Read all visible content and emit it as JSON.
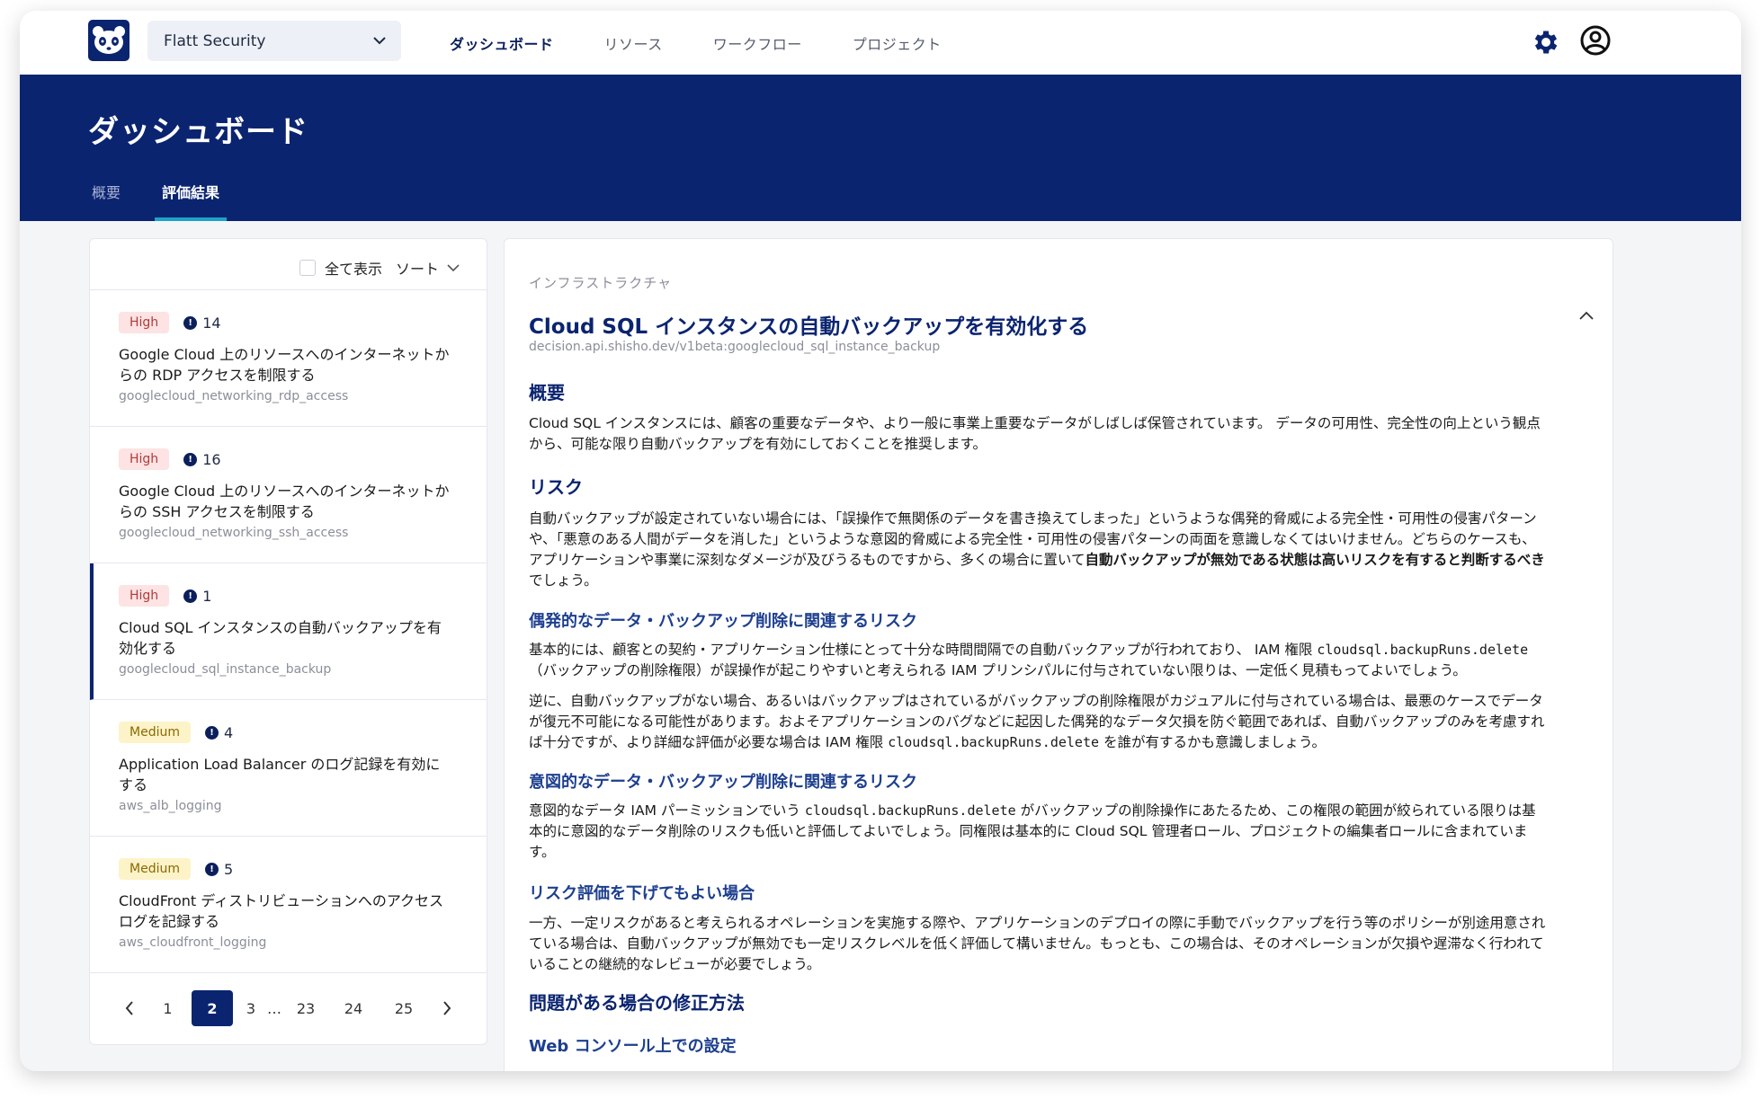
{
  "nav": {
    "org": "Flatt Security",
    "links": [
      "ダッシュボード",
      "リソース",
      "ワークフロー",
      "プロジェクト"
    ]
  },
  "banner": {
    "title": "ダッシュボード",
    "tabs": [
      "概要",
      "評価結果"
    ]
  },
  "list": {
    "show_all": "全て表示",
    "sort": "ソート",
    "items": [
      {
        "severity": "High",
        "count": "14",
        "title": "Google Cloud 上のリソースへのインターネットからの RDP アクセスを制限する",
        "id": "googlecloud_networking_rdp_access"
      },
      {
        "severity": "High",
        "count": "16",
        "title": "Google Cloud 上のリソースへのインターネットからの SSH アクセスを制限する",
        "id": "googlecloud_networking_ssh_access"
      },
      {
        "severity": "High",
        "count": "1",
        "title": "Cloud SQL インスタンスの自動バックアップを有効化する",
        "id": "googlecloud_sql_instance_backup"
      },
      {
        "severity": "Medium",
        "count": "4",
        "title": "Application Load Balancer のログ記録を有効にする",
        "id": "aws_alb_logging"
      },
      {
        "severity": "Medium",
        "count": "5",
        "title": "CloudFront ディストリビューションへのアクセスログを記録する",
        "id": "aws_cloudfront_logging"
      }
    ],
    "pager": [
      "1",
      "2",
      "3",
      "…",
      "23",
      "24",
      "25"
    ]
  },
  "detail": {
    "category": "インフラストラクチャ",
    "title": "Cloud SQL インスタンスの自動バックアップを有効化する",
    "id": "decision.api.shisho.dev/v1beta:googlecloud_sql_instance_backup",
    "overview_h": "概要",
    "overview_p1": "Cloud SQL インスタンスには、顧客の重要なデータや、より一般に事業上重要なデータがしばしば保管されています。 データの可用性、完全性の向上という観点",
    "overview_p2": "から、可能な限り自動バックアップを有効にしておくことを推奨します。",
    "risk_h": "リスク",
    "risk_l1": "自動バックアップが設定されていない場合には、「誤操作で無関係のデータを書き換えてしまった」というような偶発的脅威による完全性・可用性の侵害パターン",
    "risk_l2": "や、「悪意のある人間がデータを消した」というような意図的脅威による完全性・可用性の侵害パターンの両面を意識しなくてはいけません。どちらのケースも、",
    "risk_l3a": "アプリケーションや事業に深刻なダメージが及びうるものですから、多くの場合に置いて",
    "risk_l3b": "自動バックアップが無効である状態は高いリスクを有すると判断するべき",
    "risk_l4": "でしょう。",
    "acc_h": "偶発的なデータ・バックアップ削除に関連するリスク",
    "acc1_l1a": "基本的には、顧客との契約・アプリケーション仕様にとって十分な時間間隔での自動バックアップが行われており、 IAM 権限 ",
    "acc1_code": "cloudsql.backupRuns.delete",
    "acc1_l2": "（バックアップの削除権限）が誤操作が起こりやすいと考えられる IAM プリンシパルに付与されていない限りは、一定低く見積もってよいでしょう。",
    "acc2_l1": "逆に、自動バックアップがない場合、あるいはバックアップはされているがバックアップの削除権限がカジュアルに付与されている場合は、最悪のケースでデータ",
    "acc2_l2": "が復元不可能になる可能性があります。およそアプリケーションのバグなどに起因した偶発的なデータ欠損を防ぐ範囲であれば、自動バックアップのみを考慮すれ",
    "acc2_l3a": "ば十分ですが、より詳細な評価が必要な場合は IAM 権限 ",
    "acc2_code": "cloudsql.backupRuns.delete",
    "acc2_l3b": " を誰が有するかも意識しましょう。",
    "int_h": "意図的なデータ・バックアップ削除に関連するリスク",
    "int_l1a": "意図的なデータ IAM パーミッションでいう ",
    "int_code": "cloudsql.backupRuns.delete",
    "int_l1b": " がバックアップの削除操作にあたるため、この権限の範囲が絞られている限りは基",
    "int_l2": "本的に意図的なデータ削除のリスクも低いと評価してよいでしょう。同権限は基本的に Cloud SQL 管理者ロール、プロジェクトの編集者ロールに含まれていま",
    "int_l3": "す。",
    "lower_h": "リスク評価を下げてもよい場合",
    "lower_l1": "一方、一定リスクがあると考えられるオペレーションを実施する際や、アプリケーションのデプロイの際に手動でバックアップを行う等のポリシーが別途用意され",
    "lower_l2": "ている場合は、自動バックアップが無効でも一定リスクレベルを低く評価して構いません。もっとも、この場合は、そのオペレーションが欠損や遅滞なく行われて",
    "lower_l3": "いることの継続的なレビューが必要でしょう。",
    "fix_h": "問題がある場合の修正方法",
    "web_h": "Web コンソール上での設定"
  }
}
